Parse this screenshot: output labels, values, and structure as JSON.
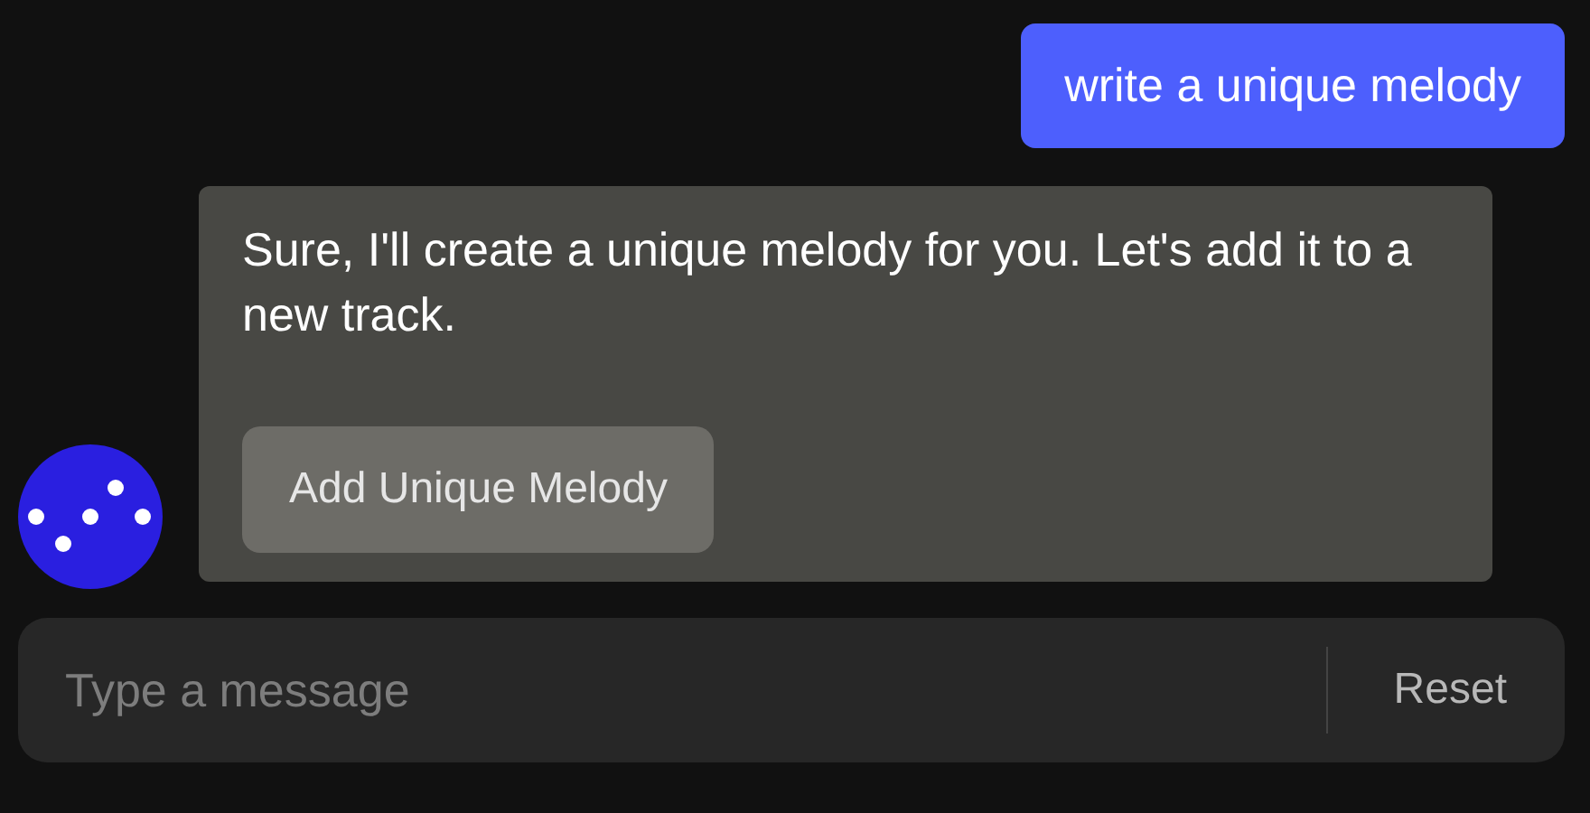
{
  "messages": [
    {
      "kind": "user",
      "text": "write a unique melody"
    },
    {
      "kind": "assistant",
      "text": "Sure, I'll create a unique melody for you. Let's add it to a new track.",
      "action": "Add Unique Melody"
    }
  ],
  "composer": {
    "placeholder": "Type a message",
    "button": "Reset"
  }
}
